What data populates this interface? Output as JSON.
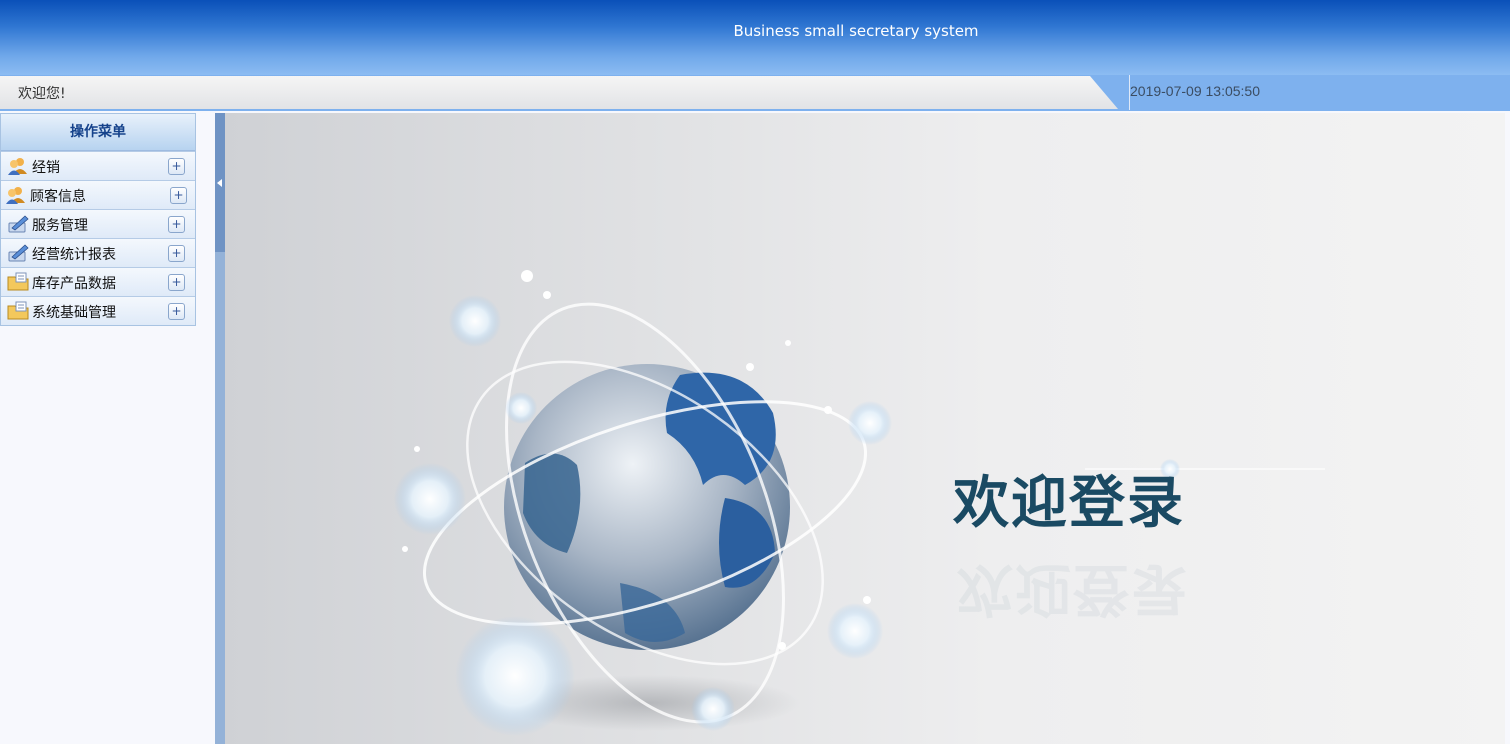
{
  "header": {
    "title": "Business small secretary system"
  },
  "infobar": {
    "welcome": "欢迎您!",
    "datetime": "2019-07-09 13:05:50"
  },
  "menu": {
    "title": "操作菜单",
    "items": [
      {
        "label": "经销",
        "icon": "users-icon"
      },
      {
        "label": "顾客信息",
        "icon": "users-icon"
      },
      {
        "label": "服务管理",
        "icon": "pencil-icon"
      },
      {
        "label": "经营统计报表",
        "icon": "pencil-icon"
      },
      {
        "label": "库存产品数据",
        "icon": "folder-icon"
      },
      {
        "label": "系统基础管理",
        "icon": "folder-icon"
      }
    ],
    "expand_symbol": "+"
  },
  "main": {
    "welcome_heading": "欢迎登录"
  },
  "colors": {
    "header_top": "#0a50b8",
    "header_bottom": "#8cbcf2",
    "heading": "#1a4a63"
  }
}
